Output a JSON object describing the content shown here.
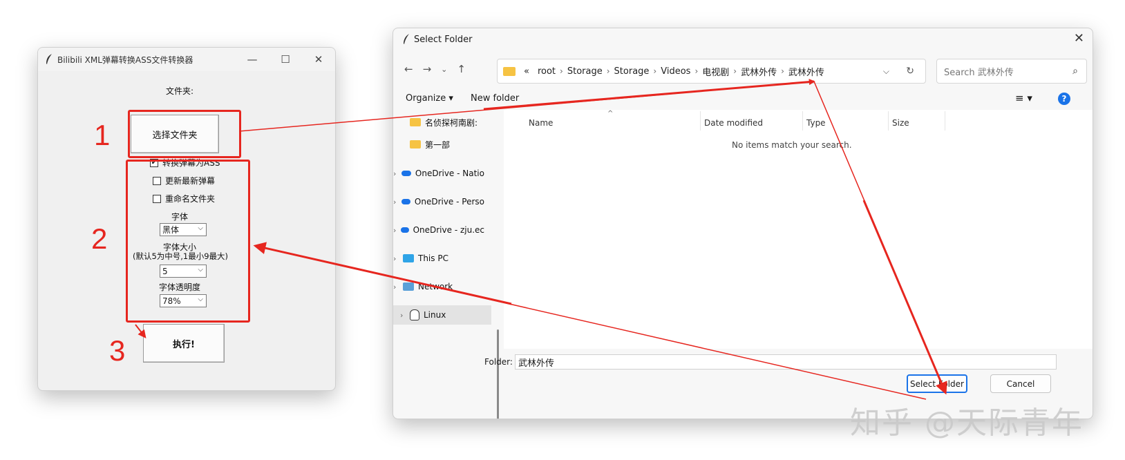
{
  "left_window": {
    "title": "Bilibili XML弹幕转换ASS文件转换器",
    "controls": {
      "minimize": "—",
      "maximize": "☐",
      "close": "✕"
    },
    "folder_label": "文件夹:",
    "select_folder_button": "选择文件夹",
    "options": [
      {
        "label": "转换弹幕为ASS",
        "checked": true
      },
      {
        "label": "更新最新弹幕",
        "checked": false
      },
      {
        "label": "重命名文件夹",
        "checked": false
      }
    ],
    "font_label": "字体",
    "font_value": "黑体",
    "size_label": "字体大小",
    "size_hint": "(默认5为中号,1最小9最大)",
    "size_value": "5",
    "opacity_label": "字体透明度",
    "opacity_value": "78%",
    "run_button": "执行!"
  },
  "dialog": {
    "title": "Select Folder",
    "breadcrumb": [
      "«",
      "root",
      "Storage",
      "Storage",
      "Videos",
      "电视剧",
      "武林外传",
      "武林外传"
    ],
    "search_placeholder": "Search 武林外传",
    "organize": "Organize ▾",
    "new_folder": "New folder",
    "nav_items": [
      {
        "label": "名侦探柯南剧:",
        "icon": "folder-icon",
        "expandable": false
      },
      {
        "label": "第一部",
        "icon": "folder-icon",
        "expandable": false
      },
      {
        "label": "OneDrive - Natio",
        "icon": "cloud-icon",
        "expandable": true
      },
      {
        "label": "OneDrive - Perso",
        "icon": "cloud-icon",
        "expandable": true
      },
      {
        "label": "OneDrive - zju.ec",
        "icon": "cloud-icon",
        "expandable": true
      },
      {
        "label": "This PC",
        "icon": "pc-icon",
        "expandable": true
      },
      {
        "label": "Network",
        "icon": "network-icon",
        "expandable": true
      },
      {
        "label": "Linux",
        "icon": "linux-icon",
        "expandable": true,
        "selected": true
      }
    ],
    "columns": [
      "Name",
      "Date modified",
      "Type",
      "Size"
    ],
    "empty_message": "No items match your search.",
    "folder_label": "Folder:",
    "folder_value": "武林外传",
    "select_button": "Select Folder",
    "cancel_button": "Cancel"
  },
  "annotations": {
    "numbers": [
      "1",
      "2",
      "3"
    ],
    "color": "#e6261f"
  },
  "watermark": "知乎 @天际青年"
}
